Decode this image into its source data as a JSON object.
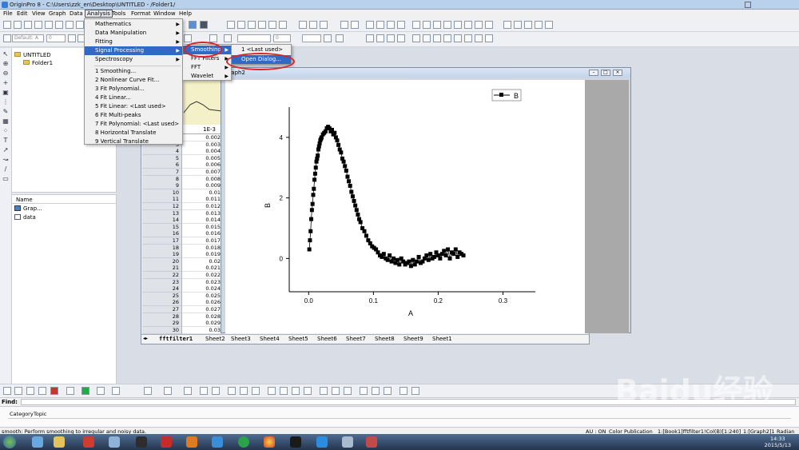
{
  "window": {
    "title": "OriginPro 8 - C:\\Users\\zzk_en\\Desktop\\UNTITLED - /Folder1/"
  },
  "menubar": [
    "File",
    "Edit",
    "View",
    "Graph",
    "Data",
    "Analysis",
    "Tools",
    "Format",
    "Window",
    "Help"
  ],
  "toolbar2": {
    "font_name": "Default: A",
    "font_size": "0"
  },
  "project": {
    "root": "UNTITLED",
    "folder": "Folder1",
    "name_header": "Name",
    "items": [
      "Grap...",
      "data"
    ]
  },
  "analysis_menu": {
    "items": [
      "Mathematics",
      "Data Manipulation",
      "Fitting",
      "Signal Processing",
      "Spectroscopy"
    ],
    "recent": [
      "1 Smoothing...",
      "2 Nonlinear Curve Fit...",
      "3 Fit Polynomial...",
      "4 Fit Linear...",
      "5 Fit Linear: <Last used>",
      "6 Fit Multi-peaks",
      "7 Fit Polynomial: <Last used>",
      "8 Horizontal Translate",
      "9 Vertical Translate"
    ]
  },
  "signal_menu": {
    "items": [
      "Smoothing",
      "FFT Filters",
      "FFT",
      "Wavelet"
    ]
  },
  "smoothing_menu": {
    "items": [
      "1 <Last used>",
      "Open Dialog..."
    ]
  },
  "worksheet": {
    "header_cell": "1E-3",
    "rows": [
      {
        "n": "",
        "v": "0.002"
      },
      {
        "n": "3",
        "v": "0.003"
      },
      {
        "n": "4",
        "v": "0.004"
      },
      {
        "n": "5",
        "v": "0.005"
      },
      {
        "n": "6",
        "v": "0.006"
      },
      {
        "n": "7",
        "v": "0.007"
      },
      {
        "n": "8",
        "v": "0.008"
      },
      {
        "n": "9",
        "v": "0.009"
      },
      {
        "n": "10",
        "v": "0.01"
      },
      {
        "n": "11",
        "v": "0.011"
      },
      {
        "n": "12",
        "v": "0.012"
      },
      {
        "n": "13",
        "v": "0.013"
      },
      {
        "n": "14",
        "v": "0.014"
      },
      {
        "n": "15",
        "v": "0.015"
      },
      {
        "n": "16",
        "v": "0.016"
      },
      {
        "n": "17",
        "v": "0.017"
      },
      {
        "n": "18",
        "v": "0.018"
      },
      {
        "n": "19",
        "v": "0.019"
      },
      {
        "n": "20",
        "v": "0.02"
      },
      {
        "n": "21",
        "v": "0.021"
      },
      {
        "n": "22",
        "v": "0.022"
      },
      {
        "n": "23",
        "v": "0.023"
      },
      {
        "n": "24",
        "v": "0.024"
      },
      {
        "n": "25",
        "v": "0.025"
      },
      {
        "n": "26",
        "v": "0.026"
      },
      {
        "n": "27",
        "v": "0.027"
      },
      {
        "n": "28",
        "v": "0.028"
      },
      {
        "n": "29",
        "v": "0.029"
      },
      {
        "n": "30",
        "v": "0.03"
      }
    ],
    "tabs": [
      "fftfilter1",
      "Sheet2",
      "Sheet3",
      "Sheet4",
      "Sheet5",
      "Sheet6",
      "Sheet7",
      "Sheet8",
      "Sheet9",
      "Sheet1"
    ]
  },
  "graph": {
    "title": "Graph2",
    "legend": "B"
  },
  "chart_data": {
    "type": "scatter",
    "xlabel": "A",
    "ylabel": "B",
    "xlim": [
      -0.03,
      0.35
    ],
    "ylim": [
      -1.1,
      5.0
    ],
    "xticks": [
      "0.0",
      "0.1",
      "0.2",
      "0.3"
    ],
    "yticks": [
      "0",
      "2",
      "4"
    ],
    "series": [
      {
        "name": "B",
        "color": "#000000",
        "x": [
          0.001,
          0.002,
          0.003,
          0.004,
          0.005,
          0.006,
          0.007,
          0.008,
          0.009,
          0.01,
          0.011,
          0.012,
          0.013,
          0.014,
          0.015,
          0.016,
          0.017,
          0.018,
          0.019,
          0.02,
          0.022,
          0.024,
          0.026,
          0.028,
          0.03,
          0.032,
          0.034,
          0.036,
          0.038,
          0.04,
          0.042,
          0.044,
          0.046,
          0.048,
          0.05,
          0.052,
          0.054,
          0.056,
          0.058,
          0.06,
          0.062,
          0.064,
          0.066,
          0.068,
          0.07,
          0.072,
          0.074,
          0.076,
          0.078,
          0.08,
          0.083,
          0.086,
          0.089,
          0.092,
          0.095,
          0.098,
          0.101,
          0.104,
          0.107,
          0.11,
          0.113,
          0.116,
          0.119,
          0.122,
          0.125,
          0.128,
          0.131,
          0.134,
          0.137,
          0.14,
          0.143,
          0.146,
          0.149,
          0.152,
          0.155,
          0.158,
          0.161,
          0.164,
          0.167,
          0.17,
          0.173,
          0.176,
          0.179,
          0.182,
          0.185,
          0.188,
          0.191,
          0.194,
          0.197,
          0.2,
          0.203,
          0.206,
          0.209,
          0.212,
          0.215,
          0.218,
          0.221,
          0.224,
          0.227,
          0.23,
          0.233,
          0.236,
          0.239
        ],
        "y": [
          0.3,
          0.6,
          0.9,
          1.3,
          1.6,
          1.8,
          2.1,
          2.3,
          2.6,
          2.8,
          3.0,
          3.2,
          3.3,
          3.4,
          3.6,
          3.7,
          3.8,
          3.9,
          3.95,
          4.0,
          4.1,
          4.15,
          4.2,
          4.3,
          4.35,
          4.3,
          4.2,
          4.25,
          4.1,
          4.15,
          4.0,
          3.9,
          3.75,
          3.6,
          3.5,
          3.3,
          3.2,
          3.05,
          2.9,
          2.7,
          2.55,
          2.4,
          2.2,
          2.05,
          1.9,
          1.75,
          1.6,
          1.45,
          1.3,
          1.2,
          1.0,
          0.9,
          0.75,
          0.6,
          0.5,
          0.4,
          0.35,
          0.3,
          0.2,
          0.1,
          0.05,
          0.15,
          0.0,
          -0.05,
          0.1,
          -0.1,
          0.0,
          -0.15,
          -0.05,
          -0.2,
          0.0,
          -0.1,
          -0.2,
          -0.15,
          -0.1,
          -0.25,
          -0.05,
          -0.2,
          -0.1,
          0.05,
          -0.15,
          -0.1,
          0.0,
          0.1,
          -0.05,
          0.15,
          0.0,
          0.05,
          0.2,
          0.1,
          0.0,
          0.15,
          0.25,
          0.1,
          0.3,
          0.0,
          0.2,
          0.15,
          0.3,
          0.05,
          0.2,
          0.15,
          0.1
        ]
      }
    ]
  },
  "find": {
    "label": "Find:",
    "cols": [
      "Category",
      "Topic"
    ]
  },
  "status": {
    "left": "smooth: Perform smoothing to irregular and noisy data.",
    "au": "AU : ON",
    "theme": "Color Publication",
    "book": "1:[Book1]fftfilter1!Col(B)[1:240]",
    "graph": "1:[Graph2]1",
    "unit": "Radian"
  },
  "clock": {
    "time": "14:33",
    "date": "2015/5/13"
  },
  "watermark": "Baidu经验"
}
